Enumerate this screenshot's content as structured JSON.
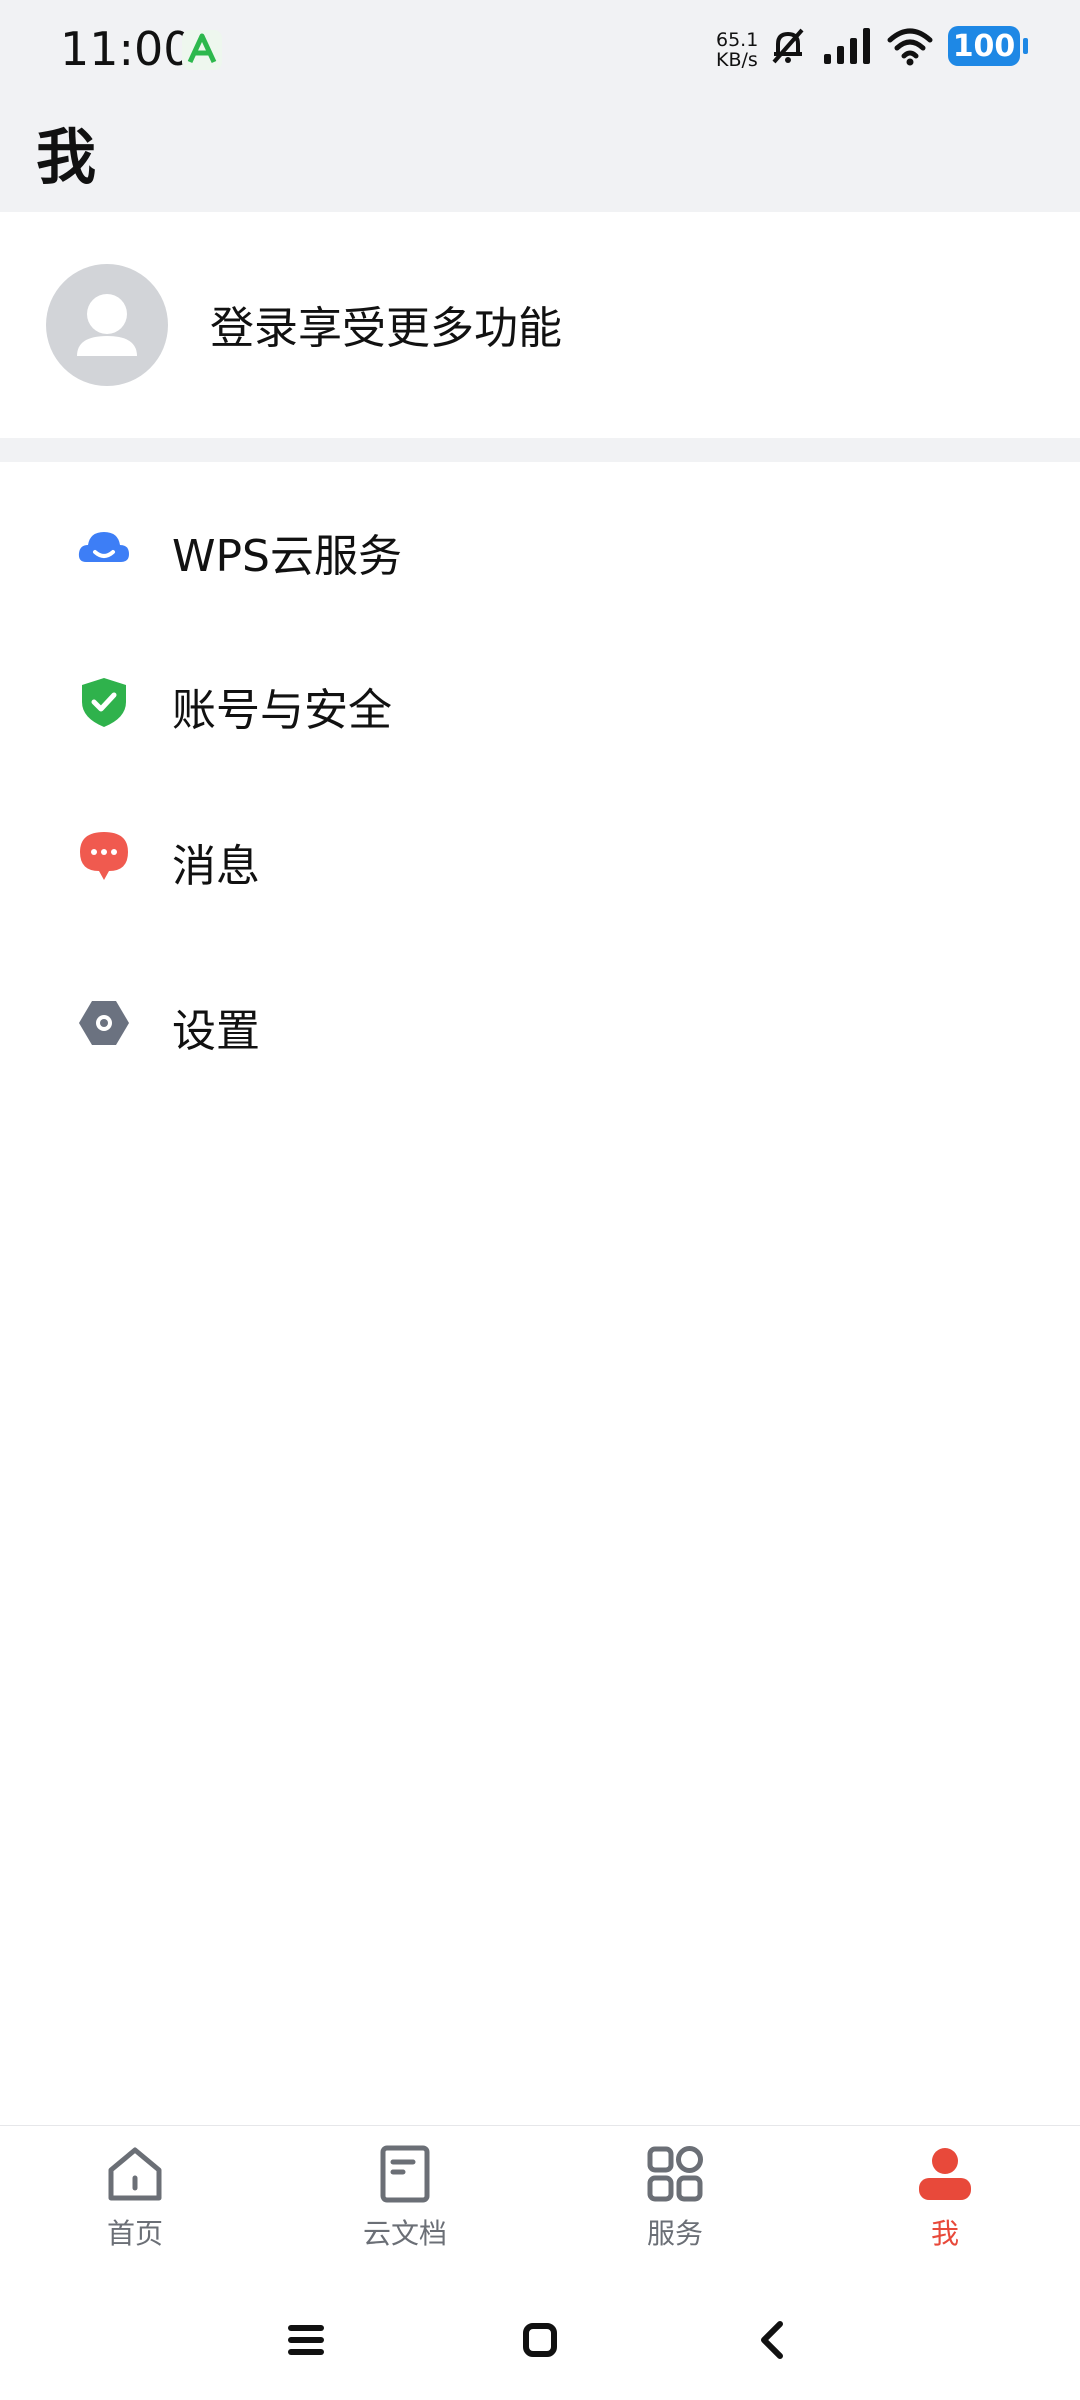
{
  "status_bar": {
    "time": "11:00",
    "net_speed_value": "65.1",
    "net_speed_unit": "KB/s",
    "battery": "100"
  },
  "header": {
    "title": "我"
  },
  "profile": {
    "login_prompt": "登录享受更多功能"
  },
  "menu": {
    "items": [
      {
        "label": "WPS云服务",
        "icon": "cloud-icon",
        "color": "#3d7ef6"
      },
      {
        "label": "账号与安全",
        "icon": "shield-check-icon",
        "color": "#2fb24c"
      },
      {
        "label": "消息",
        "icon": "message-icon",
        "color": "#f05a4f"
      },
      {
        "label": "设置",
        "icon": "settings-icon",
        "color": "#6b7280"
      }
    ]
  },
  "tabs": [
    {
      "label": "首页",
      "icon": "home-icon",
      "active": false
    },
    {
      "label": "云文档",
      "icon": "document-icon",
      "active": false
    },
    {
      "label": "服务",
      "icon": "grid-icon",
      "active": false
    },
    {
      "label": "我",
      "icon": "person-icon",
      "active": true
    }
  ],
  "colors": {
    "accent": "#e8493a",
    "header_bg": "#f1f2f4",
    "inactive_tab": "#6b6f76"
  }
}
